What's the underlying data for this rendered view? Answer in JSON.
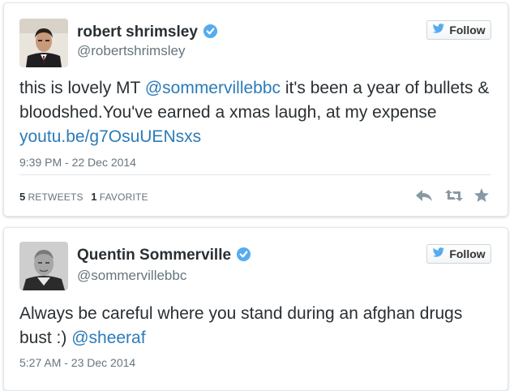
{
  "tweets": [
    {
      "name": "robert shrimsley",
      "handle": "@robertshrimsley",
      "follow_label": "Follow",
      "text": {
        "part1": "this is lovely MT ",
        "mention": "@sommervillebbc",
        "part2": " it's been a year of bullets & bloodshed.You've earned a xmas laugh, at my expense ",
        "link": "youtu.be/g7OsuUENsxs"
      },
      "timestamp": "9:39 PM - 22 Dec 2014",
      "stats": {
        "retweets_count": "5",
        "retweets_label": "RETWEETS",
        "favorites_count": "1",
        "favorites_label": "FAVORITE"
      }
    },
    {
      "name": "Quentin Sommerville",
      "handle": "@sommervillebbc",
      "follow_label": "Follow",
      "text": {
        "part1": "Always be careful where you stand during an afghan drugs bust :) ",
        "mention": "@sheeraf"
      },
      "timestamp": "5:27 AM - 23 Dec 2014"
    }
  ],
  "colors": {
    "link": "#2b7bb9",
    "verified": "#55acee",
    "muted": "#66757f",
    "action_icons": "#8899a6"
  },
  "icons": [
    "verified-badge-icon",
    "twitter-bird-icon",
    "reply-icon",
    "retweet-icon",
    "favorite-star-icon"
  ]
}
